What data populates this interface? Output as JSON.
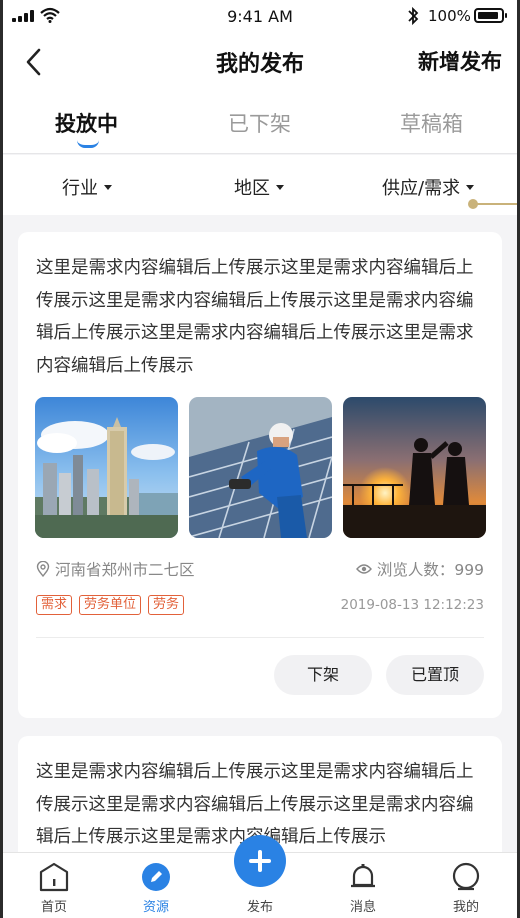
{
  "status_bar": {
    "time": "9:41 AM",
    "battery": "100%"
  },
  "header": {
    "title": "我的发布",
    "action_label": "新增发布"
  },
  "tabs": [
    {
      "label": "投放中",
      "active": true
    },
    {
      "label": "已下架",
      "active": false
    },
    {
      "label": "草稿箱",
      "active": false
    }
  ],
  "filters": [
    {
      "label": "行业"
    },
    {
      "label": "地区"
    },
    {
      "label": "供应/需求"
    }
  ],
  "posts": [
    {
      "description": "这里是需求内容编辑后上传展示这里是需求内容编辑后上传展示这里是需求内容编辑后上传展示这里是需求内容编辑后上传展示这里是需求内容编辑后上传展示这里是需求内容编辑后上传展示",
      "photos": [
        "city-skyline-photo",
        "solar-worker-photo",
        "sunset-construction-photo"
      ],
      "location": "河南省郑州市二七区",
      "views": "浏览人数：999",
      "tags": [
        "需求",
        "劳务单位",
        "劳务"
      ],
      "datetime": "2019-08-13  12:12:23",
      "actions": [
        "下架",
        "已置顶"
      ]
    },
    {
      "description": "这里是需求内容编辑后上传展示这里是需求内容编辑后上传展示这里是需求内容编辑后上传展示这里是需求内容编辑后上传展示这里是需求内容编辑后上传展示"
    }
  ],
  "tabbar": [
    {
      "label": "首页",
      "icon": "home-icon",
      "active": false
    },
    {
      "label": "资源",
      "icon": "edit-icon",
      "active": true
    },
    {
      "label": "发布",
      "icon": "plus-icon",
      "active": false
    },
    {
      "label": "消息",
      "icon": "bell-icon",
      "active": false
    },
    {
      "label": "我的",
      "icon": "profile-icon",
      "active": false
    }
  ],
  "colors": {
    "accent": "#2a82e4",
    "tag": "#e2613a",
    "background": "#f4f4f6"
  }
}
